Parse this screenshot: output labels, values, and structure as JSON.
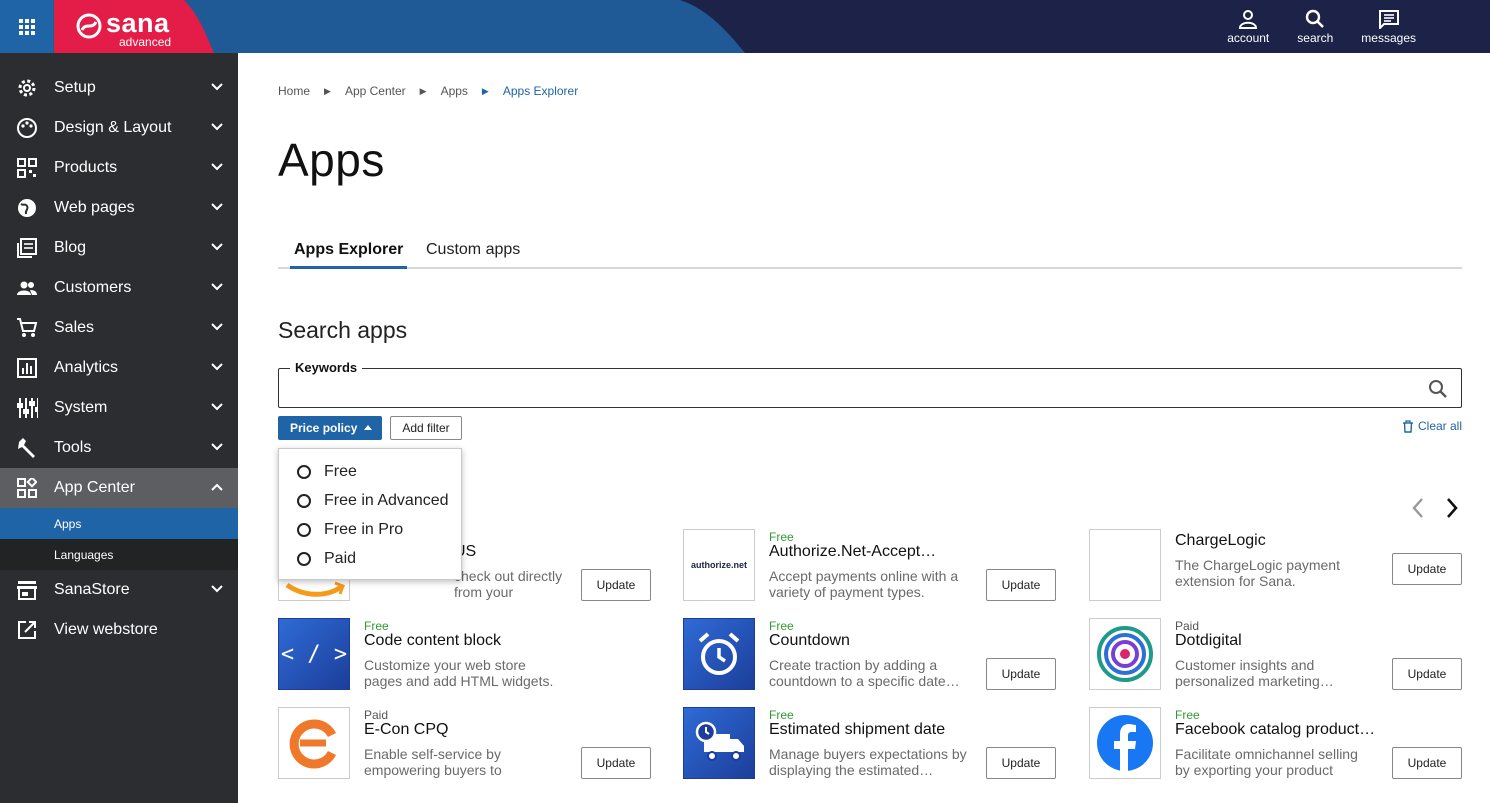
{
  "brand": {
    "name": "sana",
    "edition": "advanced",
    "colors": {
      "red": "#e31d47",
      "blue": "#1f64a6",
      "navy": "#1c2248"
    }
  },
  "top_actions": [
    {
      "label": "account",
      "icon": "account-icon"
    },
    {
      "label": "search",
      "icon": "search-icon"
    },
    {
      "label": "messages",
      "icon": "messages-icon"
    }
  ],
  "sidebar": {
    "items": [
      {
        "label": "Setup",
        "icon": "gear-icon"
      },
      {
        "label": "Design & Layout",
        "icon": "palette-icon"
      },
      {
        "label": "Products",
        "icon": "qr-icon"
      },
      {
        "label": "Web pages",
        "icon": "globe-icon"
      },
      {
        "label": "Blog",
        "icon": "blog-icon"
      },
      {
        "label": "Customers",
        "icon": "people-icon"
      },
      {
        "label": "Sales",
        "icon": "cart-icon"
      },
      {
        "label": "Analytics",
        "icon": "analytics-icon"
      },
      {
        "label": "System",
        "icon": "sliders-icon"
      },
      {
        "label": "Tools",
        "icon": "wrench-icon"
      },
      {
        "label": "App Center",
        "icon": "apps-icon"
      }
    ],
    "subitems": [
      {
        "label": "Apps",
        "selected": true
      },
      {
        "label": "Languages",
        "selected": false
      }
    ],
    "bottom_items": [
      {
        "label": "SanaStore",
        "icon": "store-icon"
      },
      {
        "label": "View webstore",
        "icon": "external-link-icon"
      }
    ]
  },
  "breadcrumb": [
    "Home",
    "App Center",
    "Apps",
    "Apps Explorer"
  ],
  "page_title": "Apps",
  "tabs": [
    {
      "label": "Apps Explorer",
      "active": true
    },
    {
      "label": "Custom apps",
      "active": false
    }
  ],
  "search": {
    "title": "Search apps",
    "keywords_label": "Keywords",
    "keywords_value": "",
    "price_policy_label": "Price policy",
    "add_filter_label": "Add filter",
    "clear_all_label": "Clear all",
    "price_options": [
      "Free",
      "Free in Advanced",
      "Free in Pro",
      "Paid"
    ]
  },
  "apps": [
    {
      "price": "",
      "name": "US",
      "desc": "check out directly from your webstore.",
      "action": "Update"
    },
    {
      "price": "Free",
      "name": "Authorize.Net-Accept…",
      "desc": "Accept payments online with a variety of payment types.",
      "action": "Update",
      "logo_text": "authorize.net"
    },
    {
      "price": "",
      "name": "ChargeLogic",
      "desc": "The ChargeLogic payment extension for Sana.",
      "action": "Update"
    },
    {
      "price": "Free",
      "name": "Code content block",
      "desc": "Customize your web store pages and add HTML widgets.",
      "action": "Update",
      "logo_text": "< / >"
    },
    {
      "price": "Free",
      "name": "Countdown",
      "desc": "Create traction by adding a countdown to a specific date…",
      "action": "Update"
    },
    {
      "price": "Paid",
      "name": "Dotdigital",
      "desc": "Customer insights and personalized marketing…",
      "action": "Update"
    },
    {
      "price": "Paid",
      "name": "E-Con CPQ",
      "desc": "Enable self-service by empowering buyers to configu…",
      "action": "Update"
    },
    {
      "price": "Free",
      "name": "Estimated shipment date",
      "desc": "Manage buyers expectations by displaying the estimated…",
      "action": "Update"
    },
    {
      "price": "Free",
      "name": "Facebook catalog product…",
      "desc": "Facilitate omnichannel selling by exporting your product data…",
      "action": "Update"
    }
  ]
}
